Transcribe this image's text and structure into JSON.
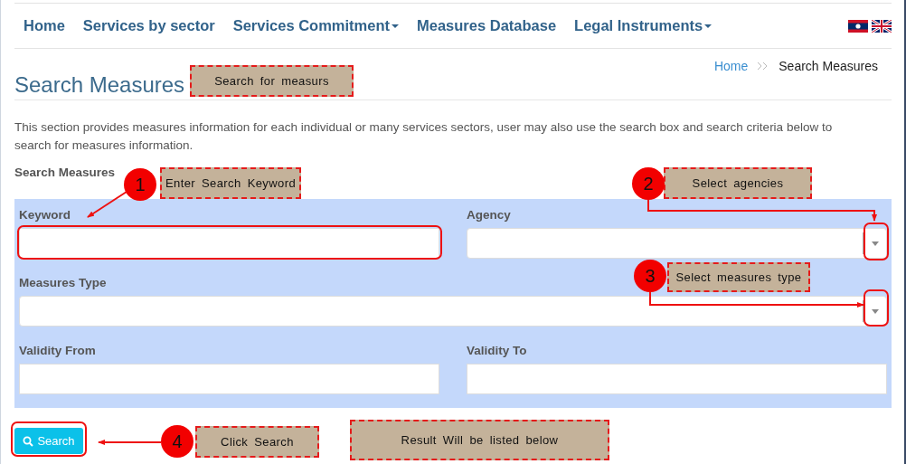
{
  "nav": {
    "items": [
      {
        "label": "Home",
        "has_caret": false
      },
      {
        "label": "Services by sector",
        "has_caret": false
      },
      {
        "label": "Services Commitment",
        "has_caret": true
      },
      {
        "label": "Measures Database",
        "has_caret": false
      },
      {
        "label": "Legal Instruments",
        "has_caret": true
      }
    ]
  },
  "breadcrumb": [
    "Home",
    "Search Measures"
  ],
  "page_title": "Search Measures",
  "description": "This section provides measures information for each individual or many services sectors, user may also use the search box and search criteria below to search for measures information.",
  "form": {
    "title": "Search Measures",
    "fields": [
      {
        "label": "Keyword",
        "kind": "text",
        "wide": false
      },
      {
        "label": "Agency",
        "kind": "select",
        "wide": false
      },
      {
        "label": "Measures Type",
        "kind": "select",
        "wide": true
      },
      {
        "label": "Validity From",
        "kind": "text",
        "wide": false
      },
      {
        "label": "Validity To",
        "kind": "text",
        "wide": false
      }
    ],
    "button": "Search"
  },
  "annotations": [
    {
      "label": "Search for measurs"
    },
    {
      "number": "1",
      "label": "Enter Search Keyword"
    },
    {
      "number": "2",
      "label": "Select agencies"
    },
    {
      "number": "3",
      "label": "Select measures type"
    },
    {
      "number": "4",
      "label": "Click Search"
    },
    {
      "label": "Result Will be listed below"
    }
  ]
}
